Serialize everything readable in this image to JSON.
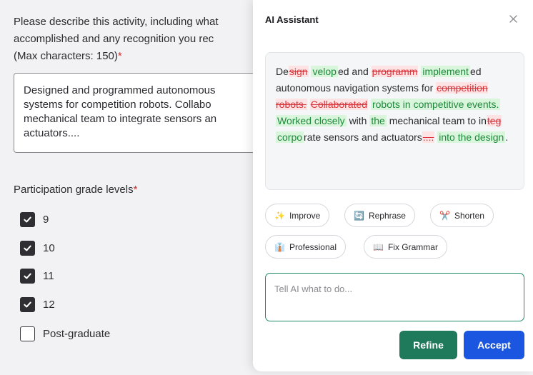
{
  "form": {
    "question_lines": [
      "Please describe this activity, including what",
      "accomplished and any recognition you rec",
      "(Max characters: 150)"
    ],
    "required_mark": "*",
    "answer_text": "Designed and programmed autonomous\nsystems for competition robots. Collabo\nmechanical team to integrate sensors an\nactuators....",
    "grade_label": "Participation grade levels",
    "grades": [
      {
        "label": "9",
        "checked": true
      },
      {
        "label": "10",
        "checked": true
      },
      {
        "label": "11",
        "checked": true
      },
      {
        "label": "12",
        "checked": true
      },
      {
        "label": "Post-graduate",
        "checked": false
      }
    ]
  },
  "panel": {
    "title": "AI Assistant",
    "close_icon": "close-icon",
    "diff": [
      {
        "t": "De",
        "k": "eq"
      },
      {
        "t": "sign",
        "k": "del"
      },
      {
        "t": "velop",
        "k": "ins"
      },
      {
        "t": "ed and",
        "k": "eq"
      },
      {
        "t": "programm",
        "k": "del"
      },
      {
        "t": "implement",
        "k": "ins"
      },
      {
        "t": "ed autonomous navigation systems for",
        "k": "eq"
      },
      {
        "t": "competition robots.",
        "k": "del"
      },
      {
        "t": "Collaborated",
        "k": "del"
      },
      {
        "t": "robots in competitive events.",
        "k": "ins"
      },
      {
        "t": "Worked closely",
        "k": "ins"
      },
      {
        "t": "with",
        "k": "eq"
      },
      {
        "t": "the",
        "k": "ins"
      },
      {
        "t": "mechanical team to in",
        "k": "eq"
      },
      {
        "t": "teg",
        "k": "del"
      },
      {
        "t": "corpo",
        "k": "ins"
      },
      {
        "t": "rate sensors and actuators",
        "k": "eq"
      },
      {
        "t": "....",
        "k": "del"
      },
      {
        "t": "into the design",
        "k": "ins"
      },
      {
        "t": ".",
        "k": "eq"
      }
    ],
    "actions": [
      {
        "label": "Improve",
        "icon": "✨",
        "icon_name": "sparkles-icon"
      },
      {
        "label": "Rephrase",
        "icon": "🔄",
        "icon_name": "rephrase-icon"
      },
      {
        "label": "Shorten",
        "icon": "✂️",
        "icon_name": "scissors-icon"
      },
      {
        "label": "Professional",
        "icon": "👔",
        "icon_name": "professional-icon"
      },
      {
        "label": "Fix Grammar",
        "icon": "📖",
        "icon_name": "book-icon"
      }
    ],
    "prompt_placeholder": "Tell AI what to do...",
    "refine_label": "Refine",
    "accept_label": "Accept"
  },
  "colors": {
    "refine": "#1f7a5c",
    "accept": "#1a56e0",
    "insert_bg": "#d9f5dc",
    "delete_bg": "#fde3e3"
  }
}
